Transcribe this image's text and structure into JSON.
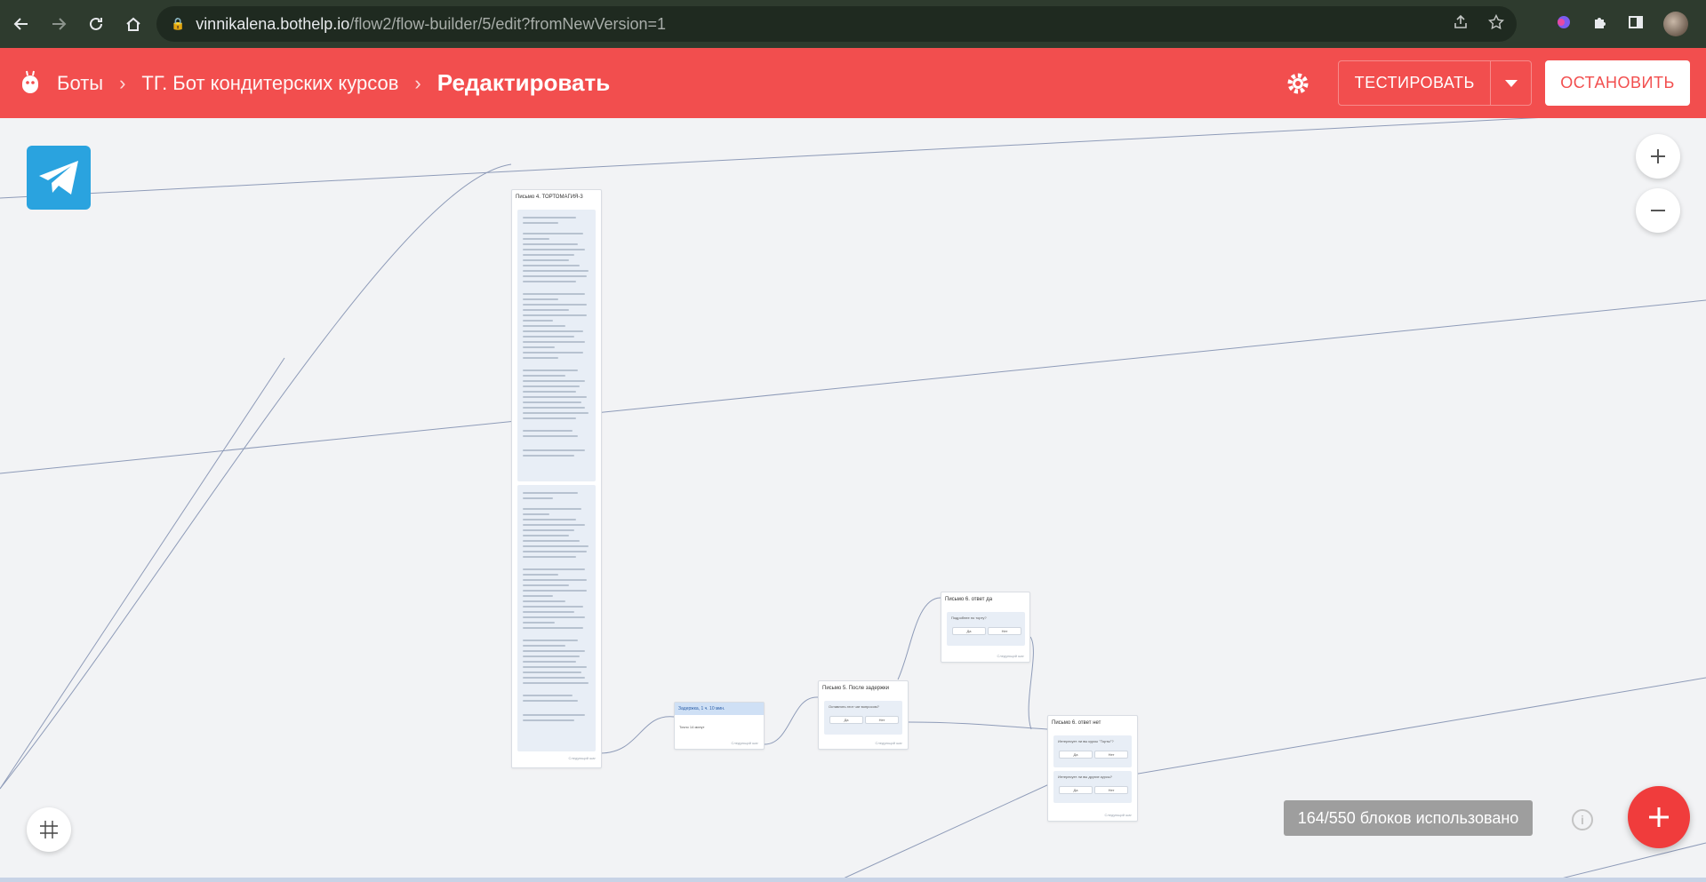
{
  "browser": {
    "url_host": "vinnikalena.bothelp.io",
    "url_path": "/flow2/flow-builder/5/edit?fromNewVersion=1"
  },
  "header": {
    "crumb_bots": "Боты",
    "crumb_bot_name": "ТГ. Бот кондитерских курсов",
    "crumb_current": "Редактировать",
    "test_label": "ТЕСТИРОВАТЬ",
    "stop_label": "ОСТАНОВИТЬ",
    "accent_color": "#f24e4e"
  },
  "canvas": {
    "usage_text": "164/550 блоков использовано",
    "channel_icon": "telegram-icon",
    "nodes": {
      "letter4_title": "Письмо 4. ТОРТОМАГИЯ-3",
      "delay_title": "Задержка, 1 ч. 10 мин.",
      "delay_body": "Точно 14 минут",
      "letter5_title": "Письмо 5. После задержки",
      "letter5_question": "Оставлять этот чат вопросом?",
      "letter6a_title": "Письмо 6. ответ да",
      "letter6a_question": "Подробнее по торту?",
      "letter6b_title": "Письмо 6. ответ нет",
      "letter6b_q1": "Интересует ли вы курсы \"Торты\"?",
      "letter6b_q2": "Интересует ли вы другие курсы?",
      "yes": "Да",
      "no": "Нет",
      "footer": "Следующий шаг"
    }
  }
}
